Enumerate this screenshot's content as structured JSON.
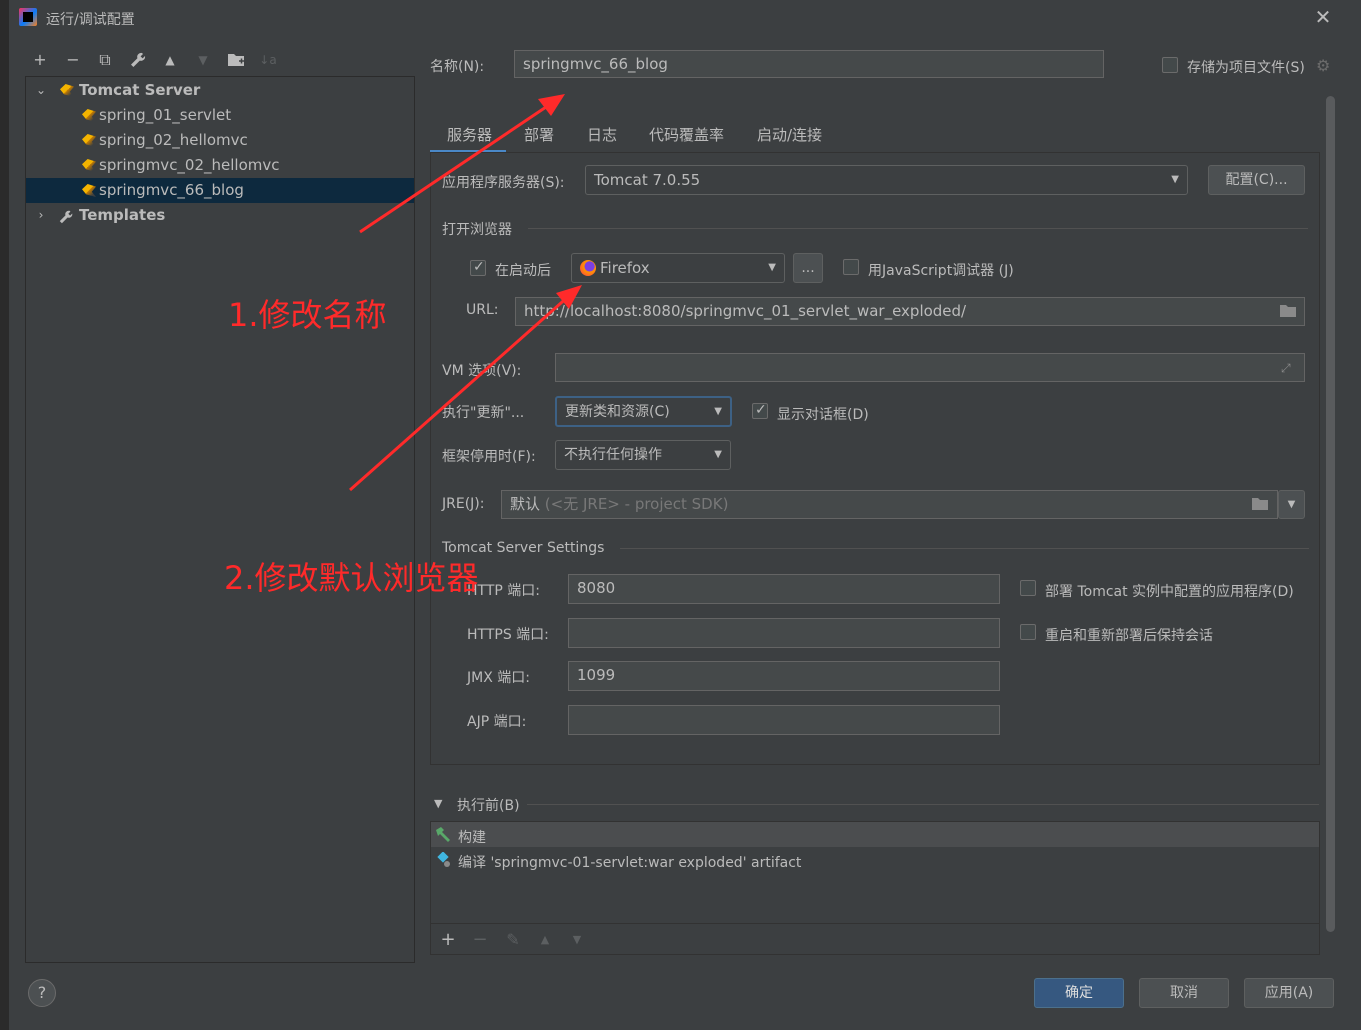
{
  "window": {
    "title": "运行/调试配置"
  },
  "toolbar": {
    "add": "+",
    "remove": "−",
    "copy": "⧉",
    "edit": "🔧",
    "up": "▲",
    "down": "▼",
    "folder": "📁",
    "sort": "↓a"
  },
  "tree": {
    "group": "Tomcat Server",
    "items": [
      "spring_01_servlet",
      "spring_02_hellomvc",
      "springmvc_02_hellomvc",
      "springmvc_66_blog"
    ],
    "selected": "springmvc_66_blog",
    "templates": "Templates"
  },
  "name_row": {
    "label": "名称(N):",
    "value": "springmvc_66_blog",
    "store_label": "存储为项目文件(S)"
  },
  "tabs": [
    "服务器",
    "部署",
    "日志",
    "代码覆盖率",
    "启动/连接"
  ],
  "server": {
    "app_server_label": "应用程序服务器(S):",
    "app_server_value": "Tomcat 7.0.55",
    "configure_btn": "配置(C)...",
    "open_browser_section": "打开浏览器",
    "after_launch_label": "在启动后",
    "browser_value": "Firefox",
    "browse_btn": "...",
    "js_debugger_label": "用JavaScript调试器 (J)",
    "url_label": "URL:",
    "url_value": "http://localhost:8080/springmvc_01_servlet_war_exploded/",
    "vm_label": "VM 选项(V):",
    "vm_value": "",
    "on_update_label": "执行\"更新\"...",
    "on_update_value": "更新类和资源(C)",
    "show_dialog_label": "显示对话框(D)",
    "frame_deact_label": "框架停用时(F):",
    "frame_deact_value": "不执行任何操作",
    "jre_label": "JRE(J):",
    "jre_value": "默认",
    "jre_hint": "(<无 JRE> - project SDK)",
    "tomcat_settings_section": "Tomcat Server Settings",
    "http_port_label": "HTTP 端口:",
    "http_port_value": "8080",
    "https_port_label": "HTTPS 端口:",
    "https_port_value": "",
    "jmx_port_label": "JMX 端口:",
    "jmx_port_value": "1099",
    "ajp_port_label": "AJP 端口:",
    "ajp_port_value": "",
    "deploy_apps_label": "部署 Tomcat 实例中配置的应用程序(D)",
    "preserve_sessions_label": "重启和重新部署后保持会话"
  },
  "before_launch": {
    "header": "执行前(B)",
    "items": [
      "构建",
      "编译 'springmvc-01-servlet:war exploded' artifact"
    ]
  },
  "footer": {
    "help": "?",
    "ok": "确定",
    "cancel": "取消",
    "apply": "应用(A)"
  },
  "annotations": {
    "step1": "1.修改名称",
    "step2": "2.修改默认浏览器"
  },
  "colors": {
    "background": "#3c3f41",
    "selection": "#0d293e",
    "accent": "#4a88c7",
    "annotation": "#ff2a2a",
    "primary_button": "#365880"
  }
}
